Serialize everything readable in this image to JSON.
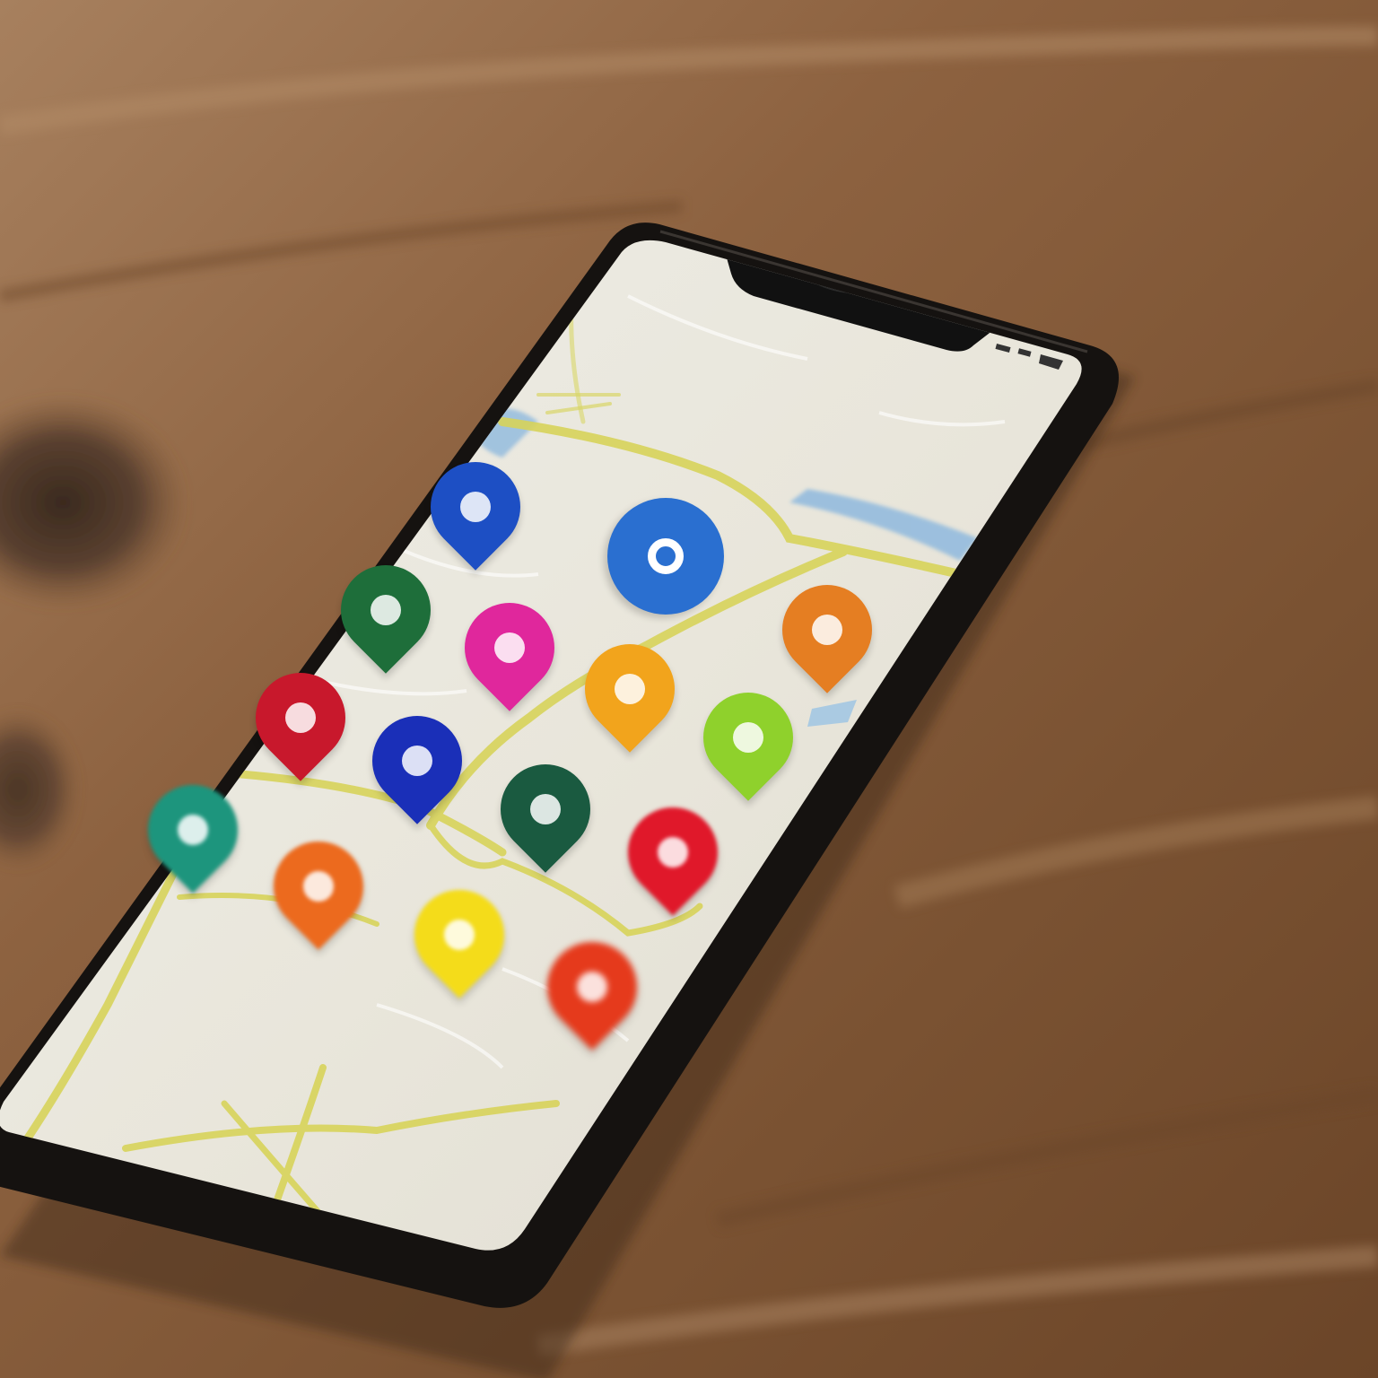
{
  "scene": {
    "subject": "smartphone-with-map-app",
    "colors": {
      "table_wood": "#8a5f3c",
      "phone_body": "#151210",
      "map_background": "#ebe8df",
      "map_roads": "#d7d35a",
      "map_water": "#8fb9de"
    },
    "status_bar_icons": [
      "signal-icon",
      "wifi-icon",
      "battery-icon"
    ]
  },
  "map": {
    "pins": [
      {
        "name": "blue-pin",
        "color": "#1d4fc4",
        "icon": "dot-icon"
      },
      {
        "name": "blue-location-marker",
        "color": "#2a6fd0",
        "icon": "ring-icon"
      },
      {
        "name": "green-pin",
        "color": "#1e6e3a",
        "icon": "map-icon"
      },
      {
        "name": "magenta-pin",
        "color": "#e0279c",
        "icon": "place-icon"
      },
      {
        "name": "orange-pin-top",
        "color": "#e57e22",
        "icon": "dot-icon"
      },
      {
        "name": "amber-pin",
        "color": "#f2a41c",
        "icon": "dot-icon"
      },
      {
        "name": "red-pin-left",
        "color": "#c8182c",
        "icon": "place-icon"
      },
      {
        "name": "royal-blue-pin",
        "color": "#1a2fb8",
        "icon": "heart-icon"
      },
      {
        "name": "lime-pin",
        "color": "#8fd12c",
        "icon": "arrow-icon"
      },
      {
        "name": "teal-pin",
        "color": "#1d957d",
        "icon": "shop-icon"
      },
      {
        "name": "dark-green-pin",
        "color": "#1a5a40",
        "icon": "shop-icon"
      },
      {
        "name": "red-pin-right",
        "color": "#e0182a",
        "icon": "heart-icon"
      },
      {
        "name": "orange-pin-bottom",
        "color": "#ec6a1e",
        "icon": "dot-icon"
      },
      {
        "name": "yellow-pin",
        "color": "#f4dc1a",
        "icon": "heart-icon"
      },
      {
        "name": "red-orange-pin",
        "color": "#e53a1c",
        "icon": "cart-icon"
      }
    ]
  }
}
